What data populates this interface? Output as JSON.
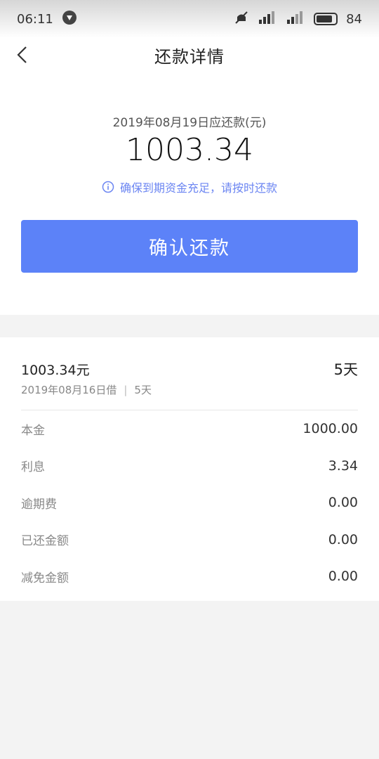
{
  "status_bar": {
    "time": "06:11",
    "battery": "84",
    "battery_level": 0.84
  },
  "nav": {
    "title": "还款详情"
  },
  "summary": {
    "due_label": "2019年08月19日应还款(元)",
    "due_amount": "1003.34",
    "notice": "确保到期资金充足，请按时还款",
    "confirm_label": "确认还款"
  },
  "loan": {
    "amount": "1003.34元",
    "term": "5天",
    "borrow_date": "2019年08月16日借",
    "days": "5天"
  },
  "breakdown": [
    {
      "label": "本金",
      "value": "1000.00"
    },
    {
      "label": "利息",
      "value": "3.34"
    },
    {
      "label": "逾期费",
      "value": "0.00"
    },
    {
      "label": "已还金额",
      "value": "0.00"
    },
    {
      "label": "减免金额",
      "value": "0.00"
    }
  ],
  "colors": {
    "accent": "#5c82f8",
    "notice": "#6c86f2",
    "background": "#f3f3f3"
  }
}
